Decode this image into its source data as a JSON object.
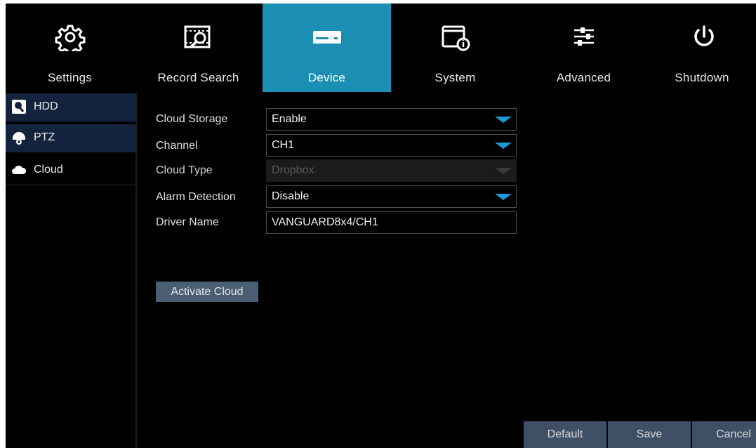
{
  "nav": {
    "tabs": [
      {
        "label": "Settings",
        "icon": "gear-icon"
      },
      {
        "label": "Record Search",
        "icon": "record-search-icon"
      },
      {
        "label": "Device",
        "icon": "hard-drive-icon",
        "active": true
      },
      {
        "label": "System",
        "icon": "system-info-icon"
      },
      {
        "label": "Advanced",
        "icon": "sliders-icon"
      },
      {
        "label": "Shutdown",
        "icon": "power-icon"
      }
    ],
    "active_color": "#1a8fb3"
  },
  "sidebar": {
    "items": [
      {
        "label": "HDD",
        "icon": "hdd-icon"
      },
      {
        "label": "PTZ",
        "icon": "ptz-camera-icon"
      },
      {
        "label": "Cloud",
        "icon": "cloud-icon",
        "active": true
      }
    ]
  },
  "form": {
    "cloud_storage": {
      "label": "Cloud Storage",
      "value": "Enable"
    },
    "channel": {
      "label": "Channel",
      "value": "CH1"
    },
    "cloud_type": {
      "label": "Cloud Type",
      "value": "Dropbox",
      "disabled": true
    },
    "alarm_detection": {
      "label": "Alarm Detection",
      "value": "Disable"
    },
    "driver_name": {
      "label": "Driver Name",
      "value": "VANGUARD8x4/CH1"
    }
  },
  "actions": {
    "activate_cloud": "Activate Cloud",
    "default": "Default",
    "save": "Save",
    "cancel": "Cancel"
  },
  "colors": {
    "dropdown_arrow": "#1d9ad6",
    "button_bg": "#3f5066"
  }
}
